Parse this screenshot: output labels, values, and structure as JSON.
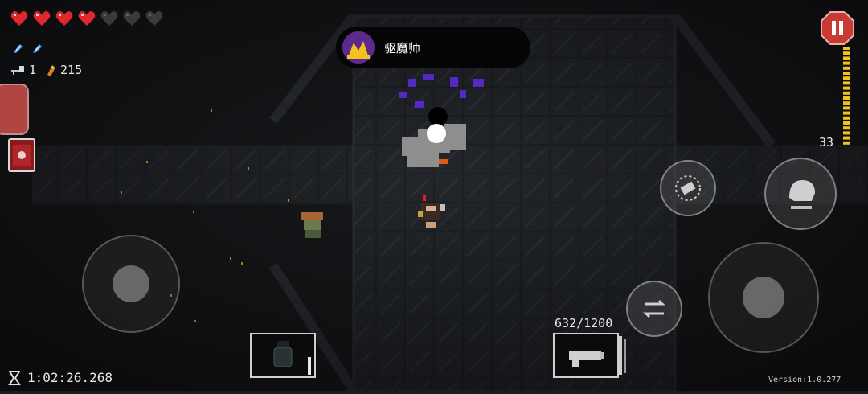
{
  "hud": {
    "hearts": [
      "full",
      "full",
      "full",
      "full",
      "empty",
      "empty",
      "empty"
    ],
    "blanks_count": 2,
    "keys": "1",
    "money": "215"
  },
  "boss": {
    "name": "驱魔师"
  },
  "ammo_clip": {
    "count": "33"
  },
  "weapon": {
    "ammo": "632/1200"
  },
  "timer": "1:02:26.268",
  "version": "Version:1.0.277",
  "colors": {
    "heart_full": "#e0282c",
    "heart_empty": "#3a3a3a",
    "floor": "#1a1b1e",
    "pause": "#c83a32",
    "clip": "#f2c21e"
  }
}
